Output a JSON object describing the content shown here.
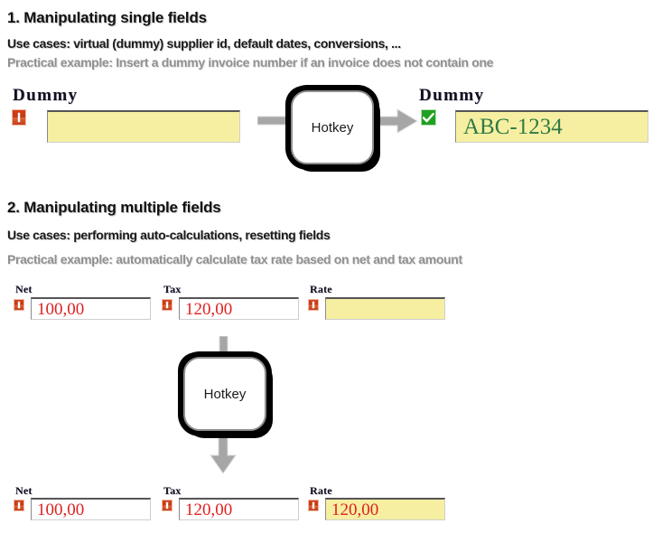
{
  "sections": [
    {
      "title": "1. Manipulating single fields",
      "use_cases": "Use cases: virtual (dummy) supplier id, default dates, conversions, ...",
      "practical_example": "Practical example: Insert a dummy invoice number if an invoice does not contain one"
    },
    {
      "title": "2. Manipulating multiple fields",
      "use_cases": "Use cases: performing auto-calculations, resetting fields",
      "practical_example": "Practical example: automatically calculate tax rate based on net and tax amount"
    }
  ],
  "hotkey": {
    "label": "Hotkey",
    "label2": "Hotkey"
  },
  "demo1": {
    "before": {
      "label": "Dummy",
      "value": "",
      "status_icon": "warning-icon"
    },
    "after": {
      "label": "Dummy",
      "value": "ABC-1234",
      "status_icon": "check-icon"
    }
  },
  "demo2": {
    "before": [
      {
        "label": "Net",
        "value": "100,00",
        "status_icon": "warning-icon"
      },
      {
        "label": "Tax",
        "value": "120,00",
        "status_icon": "warning-icon"
      },
      {
        "label": "Rate",
        "value": "",
        "status_icon": "warning-icon"
      }
    ],
    "after": [
      {
        "label": "Net",
        "value": "100,00",
        "status_icon": "warning-icon"
      },
      {
        "label": "Tax",
        "value": "120,00",
        "status_icon": "warning-icon"
      },
      {
        "label": "Rate",
        "value": "120,00",
        "status_icon": "warning-icon"
      }
    ]
  },
  "colors": {
    "field_yellow": "#f6efa2",
    "field_white": "#ffffff",
    "value_red": "#e02020",
    "value_green": "#2f7a44",
    "warning_red": "#c23d17",
    "ok_green": "#21a021",
    "arrow_gray": "#a6a6a6",
    "muted_text": "#909090"
  }
}
